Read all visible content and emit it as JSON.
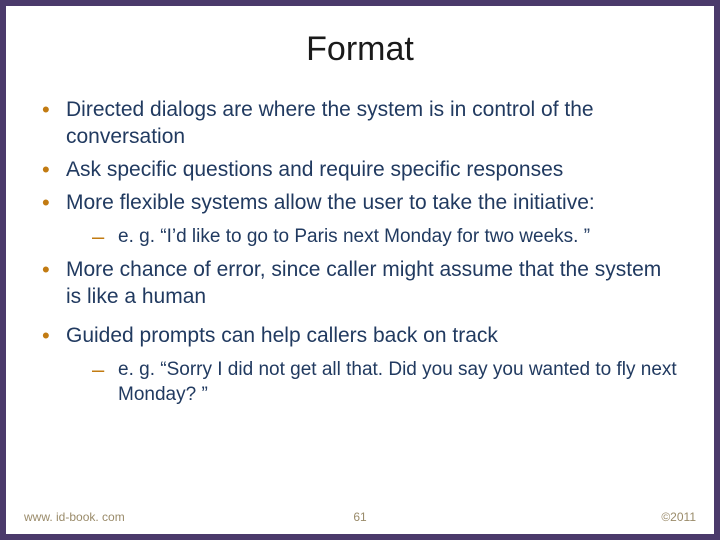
{
  "title": "Format",
  "bullets": [
    {
      "text": "Directed dialogs are where the system is in control of the conversation"
    },
    {
      "text": "Ask specific questions and require specific responses"
    },
    {
      "text": "More flexible systems allow the user to take the initiative:",
      "sub": [
        "e. g. “I’d like to go to Paris next Monday for two weeks. ”"
      ]
    },
    {
      "text": "More chance of error, since caller might assume that the system is like a human"
    },
    {
      "text": "Guided prompts can help callers back on track",
      "sub": [
        "e. g. “Sorry I did not get all that. Did you say you wanted to fly next Monday? ”"
      ]
    }
  ],
  "footer": {
    "left": "www. id-book. com",
    "center": "61",
    "right": "©2011"
  }
}
